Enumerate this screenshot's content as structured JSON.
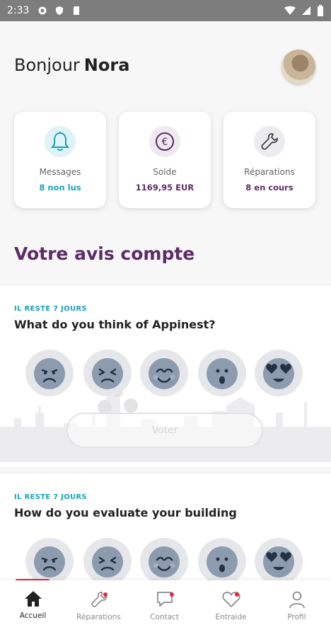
{
  "status_bar": {
    "time": "2:33"
  },
  "greeting": {
    "hello": "Bonjour",
    "name": "Nora"
  },
  "cards": [
    {
      "icon": "bell-icon",
      "label": "Messages",
      "value": "8 non lus",
      "value_color": "#1aa3b5"
    },
    {
      "icon": "euro-icon",
      "label": "Solde",
      "value": "1169,95 EUR",
      "value_color": "#5d2c66"
    },
    {
      "icon": "wrench-icon",
      "label": "Réparations",
      "value": "8 en cours",
      "value_color": "#5d2c66"
    }
  ],
  "section": {
    "title": "Votre avis compte"
  },
  "surveys": [
    {
      "remaining": "IL RESTE 7 JOURS",
      "question": "What do you think of Appinest?",
      "vote_label": "Voter"
    },
    {
      "remaining": "IL RESTE 7 JOURS",
      "question": "How do you evaluate your building"
    }
  ],
  "emoji_icons": [
    "angry-face-icon",
    "squinting-face-icon",
    "smiling-face-icon",
    "surprised-face-icon",
    "heart-eyes-face-icon"
  ],
  "tabs": [
    {
      "label": "Accueil",
      "icon": "home-icon",
      "active": true
    },
    {
      "label": "Réparations",
      "icon": "wrench-icon",
      "notification": true
    },
    {
      "label": "Contact",
      "icon": "chat-icon",
      "notification": true
    },
    {
      "label": "Entraide",
      "icon": "heart-icon",
      "notification": true
    },
    {
      "label": "Profil",
      "icon": "person-icon"
    }
  ],
  "colors": {
    "brand": "#5d2c66",
    "accent": "#1aa3b5",
    "alert": "#e3283e"
  }
}
